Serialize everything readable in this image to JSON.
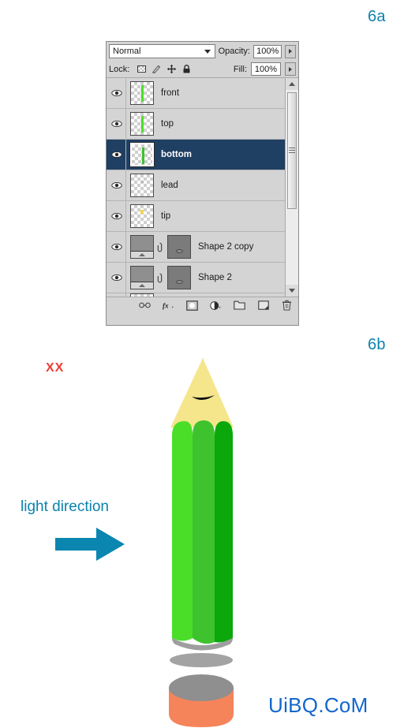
{
  "figure": {
    "label_a": "6a",
    "label_b": "6b"
  },
  "colors": {
    "label_teal": "#0b82ad",
    "brand_blue": "#1266cc",
    "xx_red": "#f03c34",
    "pencil_light_green": "#4ade28",
    "pencil_mid_green": "#3ec22e",
    "pencil_dark_green": "#0aa80a",
    "pencil_wood": "#f5e68c",
    "pencil_lead": "#111111",
    "eraser_orange": "#f5845a",
    "cap_gray": "#8f8f8f",
    "panel_bg": "#d4d4d4",
    "selected_row": "#1f3f63"
  },
  "layers_panel": {
    "blend_mode": {
      "value": "Normal",
      "icon": "chevron-down-icon"
    },
    "opacity": {
      "label": "Opacity:",
      "value": "100%",
      "stepper_icon": "stepper-arrow-icon"
    },
    "fill": {
      "label": "Fill:",
      "value": "100%",
      "stepper_icon": "stepper-arrow-icon"
    },
    "lock": {
      "label": "Lock:",
      "icons": [
        "lock-transparency-icon",
        "lock-image-pixels-icon",
        "lock-position-icon",
        "lock-all-icon"
      ]
    },
    "rows": [
      {
        "name": "front",
        "visible": true,
        "selected": false,
        "thumb": "checker-green-stroke",
        "has_mask": false,
        "linked": false
      },
      {
        "name": "top",
        "visible": true,
        "selected": false,
        "thumb": "checker-green-stroke",
        "has_mask": false,
        "linked": false
      },
      {
        "name": "bottom",
        "visible": true,
        "selected": true,
        "thumb": "checker-green-stroke",
        "has_mask": false,
        "linked": false
      },
      {
        "name": "lead",
        "visible": true,
        "selected": false,
        "thumb": "checker-empty",
        "has_mask": false,
        "linked": false
      },
      {
        "name": "tip",
        "visible": true,
        "selected": false,
        "thumb": "checker-yellow-dot",
        "has_mask": false,
        "linked": false
      },
      {
        "name": "Shape 2 copy",
        "visible": true,
        "selected": false,
        "thumb": "gradient-shape",
        "has_mask": true,
        "linked": true
      },
      {
        "name": "Shape 2",
        "visible": true,
        "selected": false,
        "thumb": "gradient-shape",
        "has_mask": true,
        "linked": true
      }
    ],
    "scrollbar": {
      "up_icon": "scroll-up-arrow-icon",
      "down_icon": "scroll-down-arrow-icon",
      "thumb_icon": "scrollbar-grip-icon"
    },
    "footer_buttons": [
      "link-layers-icon",
      "layer-style-fx-icon",
      "add-layer-mask-icon",
      "new-adjustment-layer-icon",
      "new-group-icon",
      "new-layer-icon",
      "delete-layer-icon"
    ]
  },
  "illustration": {
    "xx_mark": "XX",
    "faint_watermark": "",
    "light_direction_label": "light direction",
    "arrow_icon": "right-arrow-icon",
    "brand_watermark": "UiBQ.CoM",
    "objects": [
      "pencil-lead-tip",
      "pencil-wood-cone",
      "pencil-body-light-facet",
      "pencil-body-mid-facet",
      "pencil-body-dark-facet",
      "pencil-base-shadow",
      "ground-shadow-ellipse",
      "eraser-cylinder"
    ]
  }
}
